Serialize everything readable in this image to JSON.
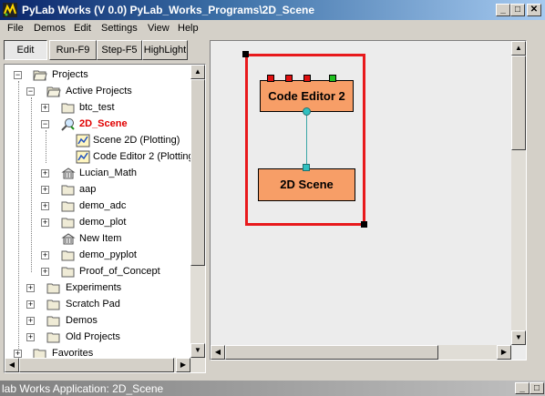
{
  "window": {
    "title": "PyLab Works (V 0.0)  PyLab_Works_Programs\\2D_Scene",
    "minimize": "_",
    "maximize": "□",
    "close": "✕"
  },
  "menu": {
    "file": "File",
    "demos": "Demos",
    "edit": "Edit",
    "settings": "Settings",
    "view": "View",
    "help": "Help"
  },
  "toolbar": {
    "edit": "Edit",
    "run": "Run-F9",
    "step": "Step-F5",
    "highlight": "HighLight"
  },
  "tree": {
    "projects": "Projects",
    "active_projects": "Active Projects",
    "btc_test": "btc_test",
    "scene_2d": "2D_Scene",
    "scene_2d_plotting": "Scene 2D (Plotting)",
    "code_editor_2_plotting": "Code Editor 2 (Plotting)",
    "lucian_math": "Lucian_Math",
    "aap": "aap",
    "demo_adc": "demo_adc",
    "demo_plot": "demo_plot",
    "new_item": "New Item",
    "demo_pyplot": "demo_pyplot",
    "proof_of_concept": "Proof_of_Concept",
    "experiments": "Experiments",
    "scratch_pad": "Scratch Pad",
    "demos": "Demos",
    "old_projects": "Old Projects",
    "favorites": "Favorites"
  },
  "canvas": {
    "block_code_editor": "Code Editor 2",
    "block_2d_scene": "2D Scene",
    "selection_color": "#e8191c",
    "block_color": "#f79e67"
  },
  "statusbar": {
    "text": "lab Works Application: 2D_Scene"
  },
  "icons": {
    "app": "pylab-app-icon",
    "folder": "folder-icon",
    "open_folder": "open-folder-icon",
    "search": "magnifier-icon",
    "plot": "plot-icon",
    "library": "library-icon",
    "page": "page-icon"
  }
}
